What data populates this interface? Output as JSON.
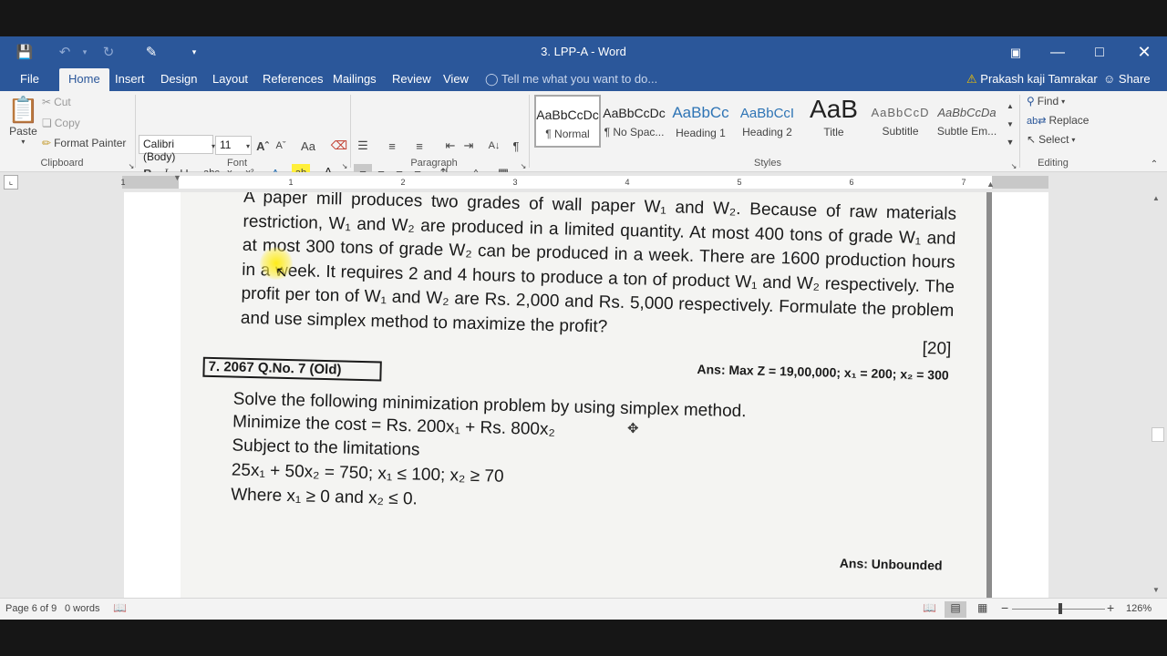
{
  "window": {
    "title": "3. LPP-A - Word",
    "user": "Prakash kaji Tamrakar",
    "share_label": "Share",
    "tell_me_placeholder": "Tell me what you want to do..."
  },
  "tabs": [
    "File",
    "Home",
    "Insert",
    "Design",
    "Layout",
    "References",
    "Mailings",
    "Review",
    "View"
  ],
  "ribbon": {
    "clipboard": {
      "paste": "Paste",
      "cut": "Cut",
      "copy": "Copy",
      "format_painter": "Format Painter",
      "label": "Clipboard"
    },
    "font": {
      "name": "Calibri (Body)",
      "size": "11",
      "label": "Font"
    },
    "paragraph": {
      "label": "Paragraph"
    },
    "styles": {
      "label": "Styles",
      "items": [
        {
          "sample": "AaBbCcDc",
          "name": "¶ Normal"
        },
        {
          "sample": "AaBbCcDc",
          "name": "¶ No Spac..."
        },
        {
          "sample": "AaBbCc",
          "name": "Heading 1"
        },
        {
          "sample": "AaBbCcI",
          "name": "Heading 2"
        },
        {
          "sample": "AaB",
          "name": "Title"
        },
        {
          "sample": "AaBbCcD",
          "name": "Subtitle"
        },
        {
          "sample": "AaBbCcDa",
          "name": "Subtle Em..."
        }
      ]
    },
    "editing": {
      "find": "Find",
      "replace": "Replace",
      "select": "Select",
      "label": "Editing"
    }
  },
  "ruler_numbers": [
    "1",
    "1",
    "2",
    "3",
    "4",
    "5",
    "6",
    "7"
  ],
  "document": {
    "q6_text": "A paper mill produces two grades of wall paper W₁ and W₂. Because of raw materials restriction, W₁ and W₂ are produced in a limited quantity. At most 400 tons of grade W₁ and at most 300 tons of grade W₂ can be produced in a week. There are 1600 production hours in a week. It requires 2 and 4 hours to produce a ton of product W₁ and W₂ respectively. The profit per ton of W₁ and W₂ are Rs. 2,000 and Rs. 5,000 respectively. Formulate the problem and use simplex method to maximize the profit?",
    "q6_marks": "[20]",
    "q6_answer": "Ans: Max Z = 19,00,000; x₁ = 200; x₂ = 300",
    "q7_header": "7.   2067 Q.No. 7 (Old)",
    "q7_lines": [
      "Solve the following minimization problem by using simplex method.",
      "Minimize the cost = Rs. 200x₁ + Rs. 800x₂",
      "Subject to the limitations",
      "25x₁ + 50x₂ = 750; x₁ ≤ 100; x₂ ≥ 70",
      "Where x₁ ≥ 0 and x₂ ≤ 0."
    ],
    "q7_answer": "Ans: Unbounded"
  },
  "status": {
    "page": "Page 6 of 9",
    "words": "0 words",
    "zoom": "126%"
  }
}
